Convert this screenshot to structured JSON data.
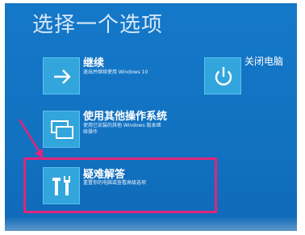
{
  "screen": {
    "title": "选择一个选项"
  },
  "options": [
    {
      "label": "继续",
      "desc": "退出并继续使用 Windows 10"
    },
    {
      "label": "使用其他操作系统",
      "desc_line1": "使用已安装的其他 Windows 版本继",
      "desc_line2": "续操作"
    },
    {
      "label": "疑难解答",
      "desc": "重置你的电脑或查看高级选项"
    },
    {
      "label": "关闭电脑"
    }
  ],
  "colors": {
    "background": "#1272c2",
    "tile": "#33a5dd",
    "highlight": "#e0257a"
  },
  "icons": [
    "arrow-right-icon",
    "windows-screens-icon",
    "tools-icon",
    "power-icon"
  ]
}
